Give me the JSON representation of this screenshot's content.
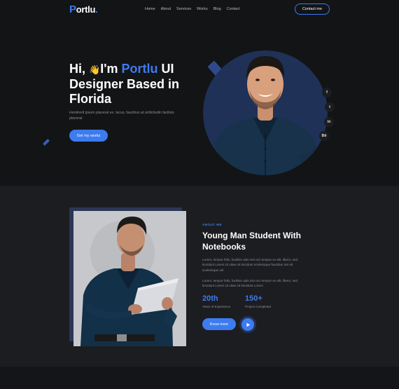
{
  "nav": {
    "logo_text": "ortlu",
    "logo_initial": "P",
    "logo_dot": ".",
    "links": [
      "Home",
      "About",
      "Services",
      "Works",
      "Blog",
      "Contact"
    ],
    "contact_label": "Contact me"
  },
  "hero": {
    "greeting": "Hi,",
    "wave": "👋",
    "im": "I'm",
    "name": "Portlu",
    "title_rest_1": "UI",
    "title_line2": "Designer Based in",
    "title_line3": "Florida",
    "description": "Hendrerit ipsum placerat ex. lacus, faucibus at sollicitudin facilisis placerat",
    "cta_label": "Get my works",
    "social": [
      "f",
      "t",
      "in",
      "Bē"
    ]
  },
  "about": {
    "label": "ABOUT ME",
    "title": "Young Man Student With Notebooks",
    "paragraph_1": "Lorem, tempor felis, facilisis odio nisi orci tempor ex elit. libero, sed tincidunt Lorem Ut vitae sit tincidunt scelerisque faucibus nisi sit scelerisque vel",
    "paragraph_2": "Lorem, tempor felis, facilisis odio nisi orci tempor ex elit. libero, sed tincidunt Lorem Ut vitae sit tincidunt Lorem",
    "stats": [
      {
        "value": "20th",
        "label": "Years of Experience"
      },
      {
        "value": "150+",
        "label": "Project Completed"
      }
    ],
    "cta_label": "Know more"
  },
  "colors": {
    "accent": "#3d7bf0",
    "background": "#131416",
    "section_bg": "#1c1d21"
  }
}
